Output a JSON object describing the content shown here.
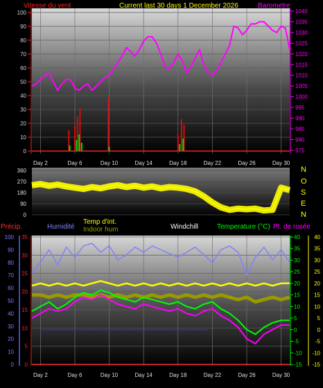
{
  "header": {
    "wind_label": "Vitesse du vent",
    "title": "Current last 30 days 1 December 2026",
    "baro_label": "Barometre"
  },
  "compass": [
    "N",
    "O",
    "S",
    "E",
    "N"
  ],
  "bottom_labels": {
    "precip": "Précip.",
    "humidity": "Humidité",
    "temp_int": "Temp d'int.",
    "indoor_hum": "Indoor hum",
    "windchill": "Windchill",
    "temperature": "Temperature (°C)",
    "dewpoint": "Pt. de rosée"
  },
  "colors": {
    "wind_label": "#ff2020",
    "title": "#ffff00",
    "baro": "#ff00ff",
    "wind_gust": "#d01010",
    "wind_avg": "#10d010",
    "direction": "#ffff00",
    "precip": "#ff3030",
    "humidity": "#8080ff",
    "temp_int": "#ffff00",
    "indoor_hum": "#999900",
    "windchill": "#ffffff",
    "temperature": "#00ff00",
    "dewpoint": "#ff00ff",
    "lowline": "#3030ff"
  },
  "chart_data": [
    {
      "type": "line",
      "title": "Current last 30 days 1 December 2026",
      "x_ticks": [
        "Day 2",
        "Day 6",
        "Day 10",
        "Day 14",
        "Day 18",
        "Day 22",
        "Day 26",
        "Day 30"
      ],
      "x_tick_days": [
        2,
        6,
        10,
        14,
        18,
        22,
        26,
        30
      ],
      "xlim": [
        1,
        31
      ],
      "y_left": {
        "label": "Vitesse du vent",
        "ticks": [
          0,
          10,
          20,
          30,
          40,
          50,
          60,
          70,
          80,
          90,
          100
        ],
        "lim": [
          0,
          100
        ]
      },
      "y_right": {
        "label": "Barometre",
        "ticks": [
          975,
          980,
          985,
          990,
          995,
          1000,
          1005,
          1010,
          1015,
          1020,
          1025,
          1030,
          1035,
          1040
        ],
        "lim": [
          974,
          1040
        ]
      },
      "series": [
        {
          "name": "Barometre",
          "axis": "right",
          "x": [
            1,
            1.5,
            2,
            2.5,
            3,
            3.5,
            4,
            4.5,
            5,
            5.5,
            6,
            6.5,
            7,
            7.5,
            8,
            8.5,
            9,
            9.5,
            10,
            10.5,
            11,
            11.5,
            12,
            12.5,
            13,
            13.5,
            14,
            14.5,
            15,
            15.5,
            16,
            16.5,
            17,
            17.5,
            18,
            18.5,
            19,
            19.5,
            20,
            20.5,
            21,
            21.5,
            22,
            22.5,
            23,
            23.5,
            24,
            24.5,
            25,
            25.5,
            26,
            26.5,
            27,
            27.5,
            28,
            28.5,
            29,
            29.5,
            30,
            30.5,
            31
          ],
          "values": [
            1005,
            1006,
            1008,
            1010,
            1011,
            1007,
            1003,
            1006,
            1008,
            1008,
            1004,
            1003,
            1005,
            1006,
            1003,
            1005,
            1007,
            1009,
            1010,
            1013,
            1016,
            1019,
            1023,
            1021,
            1019,
            1022,
            1026,
            1028,
            1028,
            1025,
            1020,
            1014,
            1013,
            1016,
            1020,
            1017,
            1011,
            1014,
            1018,
            1022,
            1015,
            1011,
            1010,
            1012,
            1016,
            1020,
            1024,
            1033,
            1032,
            1029,
            1031,
            1034,
            1034,
            1035,
            1035,
            1033,
            1031,
            1030,
            1033,
            1032,
            1022
          ]
        },
        {
          "name": "Gust",
          "axis": "left",
          "bars": [
            [
              5.3,
              15
            ],
            [
              6.0,
              18
            ],
            [
              6.3,
              25
            ],
            [
              6.6,
              31
            ],
            [
              9.9,
              39
            ],
            [
              18.0,
              12
            ],
            [
              18.4,
              23
            ],
            [
              18.7,
              19
            ]
          ]
        },
        {
          "name": "Average",
          "axis": "left",
          "bars": [
            [
              5.4,
              4
            ],
            [
              6.2,
              8
            ],
            [
              6.5,
              12
            ],
            [
              6.8,
              6
            ],
            [
              10.0,
              3
            ],
            [
              18.2,
              5
            ],
            [
              18.6,
              9
            ]
          ]
        }
      ]
    },
    {
      "type": "line",
      "x_ticks": [],
      "xlim": [
        1,
        31
      ],
      "y_left": {
        "ticks": [
          0,
          90,
          180,
          270,
          360
        ],
        "lim": [
          0,
          360
        ]
      },
      "y_right": {
        "ticks": [
          "N",
          "O",
          "S",
          "E",
          "N"
        ]
      },
      "series": [
        {
          "name": "Direction",
          "x": [
            1,
            2,
            3,
            4,
            5,
            6,
            7,
            8,
            9,
            10,
            11,
            12,
            13,
            14,
            15,
            16,
            17,
            18,
            19,
            20,
            21,
            22,
            23,
            24,
            25,
            26,
            27,
            28,
            29,
            30,
            31
          ],
          "values": [
            240,
            250,
            235,
            245,
            230,
            220,
            210,
            225,
            215,
            230,
            240,
            225,
            235,
            220,
            230,
            215,
            225,
            220,
            210,
            190,
            150,
            100,
            60,
            40,
            50,
            45,
            50,
            35,
            40,
            220,
            200
          ]
        }
      ]
    },
    {
      "type": "line",
      "x_ticks": [
        "Day 2",
        "Day 6",
        "Day 10",
        "Day 14",
        "Day 18",
        "Day 22",
        "Day 26",
        "Day 30"
      ],
      "x_tick_days": [
        2,
        6,
        10,
        14,
        18,
        22,
        26,
        30
      ],
      "xlim": [
        1,
        31
      ],
      "y_precip": {
        "ticks": [
          0,
          10,
          20,
          30,
          40,
          50,
          60,
          70,
          80,
          90,
          100
        ],
        "lim": [
          0,
          100
        ]
      },
      "y_left": {
        "ticks": [
          0,
          5,
          10,
          15,
          20,
          25,
          30,
          35
        ],
        "lim": [
          0,
          35
        ]
      },
      "y_right": {
        "ticks": [
          -15,
          -10,
          -5,
          0,
          5,
          10,
          15,
          20,
          25,
          30,
          35,
          40
        ],
        "lim": [
          -15,
          40
        ]
      },
      "series": [
        {
          "name": "Humidité",
          "axis": "precip",
          "x": [
            1,
            2,
            3,
            4,
            5,
            6,
            7,
            8,
            9,
            10,
            11,
            12,
            13,
            14,
            15,
            16,
            17,
            18,
            19,
            20,
            21,
            22,
            23,
            24,
            25,
            26,
            27,
            28,
            29,
            30,
            31
          ],
          "values": [
            72,
            80,
            90,
            78,
            92,
            84,
            93,
            95,
            88,
            93,
            82,
            86,
            92,
            88,
            93,
            90,
            87,
            84,
            88,
            92,
            86,
            80,
            90,
            93,
            88,
            70,
            84,
            92,
            82,
            90,
            80
          ]
        },
        {
          "name": "Temp d'int.",
          "axis": "right",
          "x": [
            1,
            2,
            3,
            4,
            5,
            6,
            7,
            8,
            9,
            10,
            11,
            12,
            13,
            14,
            15,
            16,
            17,
            18,
            19,
            20,
            21,
            22,
            23,
            24,
            25,
            26,
            27,
            28,
            29,
            30,
            31
          ],
          "values": [
            19,
            20,
            19,
            20,
            19,
            20,
            19,
            20,
            21,
            20,
            19,
            20,
            19,
            20,
            19,
            20,
            19,
            20,
            19,
            20,
            19,
            20,
            19,
            20,
            19,
            20,
            19,
            20,
            19,
            20,
            20
          ]
        },
        {
          "name": "Indoor hum",
          "axis": "right",
          "x": [
            1,
            2,
            3,
            4,
            5,
            6,
            7,
            8,
            9,
            10,
            11,
            12,
            13,
            14,
            15,
            16,
            17,
            18,
            19,
            20,
            21,
            22,
            23,
            24,
            25,
            26,
            27,
            28,
            29,
            30,
            31
          ],
          "values": [
            15,
            15,
            14,
            15,
            14,
            15,
            15,
            14,
            15,
            14,
            15,
            14,
            15,
            14,
            15,
            14,
            15,
            14,
            15,
            14,
            15,
            14,
            15,
            14,
            13,
            14,
            12,
            13,
            14,
            13,
            14
          ]
        },
        {
          "name": "Temperature (°C)",
          "axis": "right",
          "x": [
            1,
            2,
            3,
            4,
            5,
            6,
            7,
            8,
            9,
            10,
            11,
            12,
            13,
            14,
            15,
            16,
            17,
            18,
            19,
            20,
            21,
            22,
            23,
            24,
            25,
            26,
            27,
            28,
            29,
            30,
            31
          ],
          "values": [
            8,
            10,
            12,
            9,
            11,
            14,
            16,
            15,
            17,
            16,
            14,
            13,
            12,
            14,
            13,
            12,
            11,
            12,
            10,
            9,
            11,
            12,
            9,
            7,
            4,
            0,
            -2,
            1,
            3,
            4,
            4
          ]
        },
        {
          "name": "Pt. de rosée",
          "axis": "right",
          "x": [
            1,
            2,
            3,
            4,
            5,
            6,
            7,
            8,
            9,
            10,
            11,
            12,
            13,
            14,
            15,
            16,
            17,
            18,
            19,
            20,
            21,
            22,
            23,
            24,
            25,
            26,
            27,
            28,
            29,
            30,
            31
          ],
          "values": [
            5,
            7,
            9,
            8,
            9,
            12,
            14,
            13,
            15,
            13,
            11,
            10,
            9,
            11,
            10,
            9,
            8,
            9,
            7,
            6,
            8,
            9,
            6,
            4,
            1,
            -4,
            -6,
            -2,
            0,
            2,
            2
          ]
        }
      ]
    }
  ]
}
